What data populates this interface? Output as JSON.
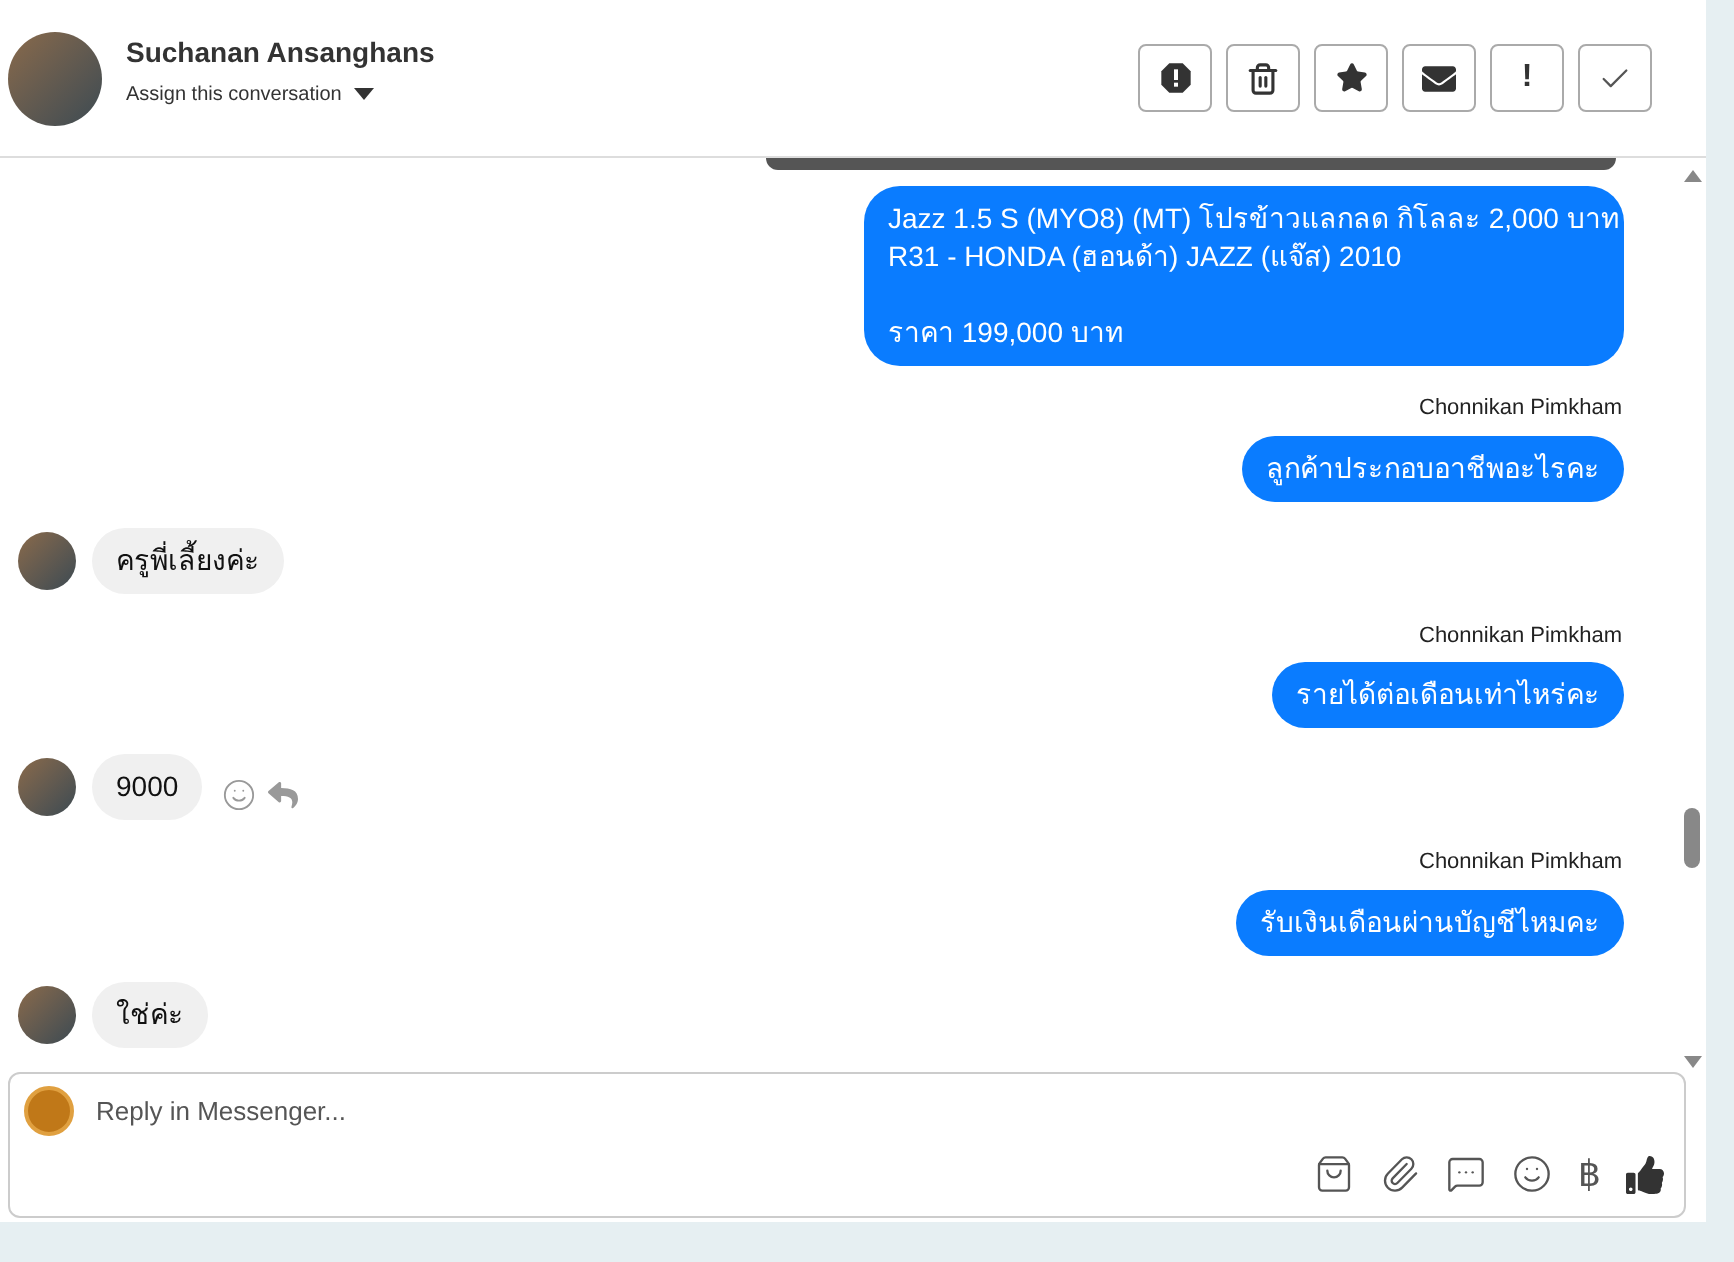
{
  "header": {
    "name": "Suchanan Ansanghans",
    "assign": "Assign this conversation",
    "actions": [
      {
        "kind": "spam"
      },
      {
        "kind": "trash"
      },
      {
        "kind": "star"
      },
      {
        "kind": "mail"
      },
      {
        "kind": "text",
        "label": "!"
      },
      {
        "kind": "check"
      }
    ]
  },
  "messages": [
    {
      "kind": "outgoing",
      "lines": [
        "Jazz 1.5 S (MYO8) (MT) โปรข้าวแลกลด กิโลละ 2,000 บาท",
        "R31 - HONDA (ฮอนด้า) JAZZ (แจ๊ส) 2010"
      ],
      "extra_lines": [
        "ราคา 199,000 บาท"
      ]
    },
    {
      "kind": "outgoing",
      "sender": "Chonnikan Pimkham",
      "lines": [
        "ลูกค้าประกอบอาชีพอะไรคะ"
      ]
    },
    {
      "kind": "incoming",
      "lines": [
        "ครูพี่เลี้ยงค่ะ"
      ],
      "actions": false
    },
    {
      "kind": "outgoing",
      "sender": "Chonnikan Pimkham",
      "lines": [
        "รายได้ต่อเดือนเท่าไหร่คะ"
      ]
    },
    {
      "kind": "incoming",
      "lines": [
        "9000"
      ],
      "actions": true
    },
    {
      "kind": "outgoing",
      "sender": "Chonnikan Pimkham",
      "lines": [
        "รับเงินเดือนผ่านบัญชีไหมคะ"
      ]
    },
    {
      "kind": "incoming",
      "lines": [
        "ใช่ค่ะ"
      ],
      "actions": false
    }
  ],
  "composer": {
    "placeholder": "Reply in Messenger...",
    "tools": [
      {
        "kind": "bag"
      },
      {
        "kind": "clip"
      },
      {
        "kind": "chat"
      },
      {
        "kind": "emoji"
      },
      {
        "kind": "text",
        "label": "฿"
      },
      {
        "kind": "like"
      }
    ]
  }
}
